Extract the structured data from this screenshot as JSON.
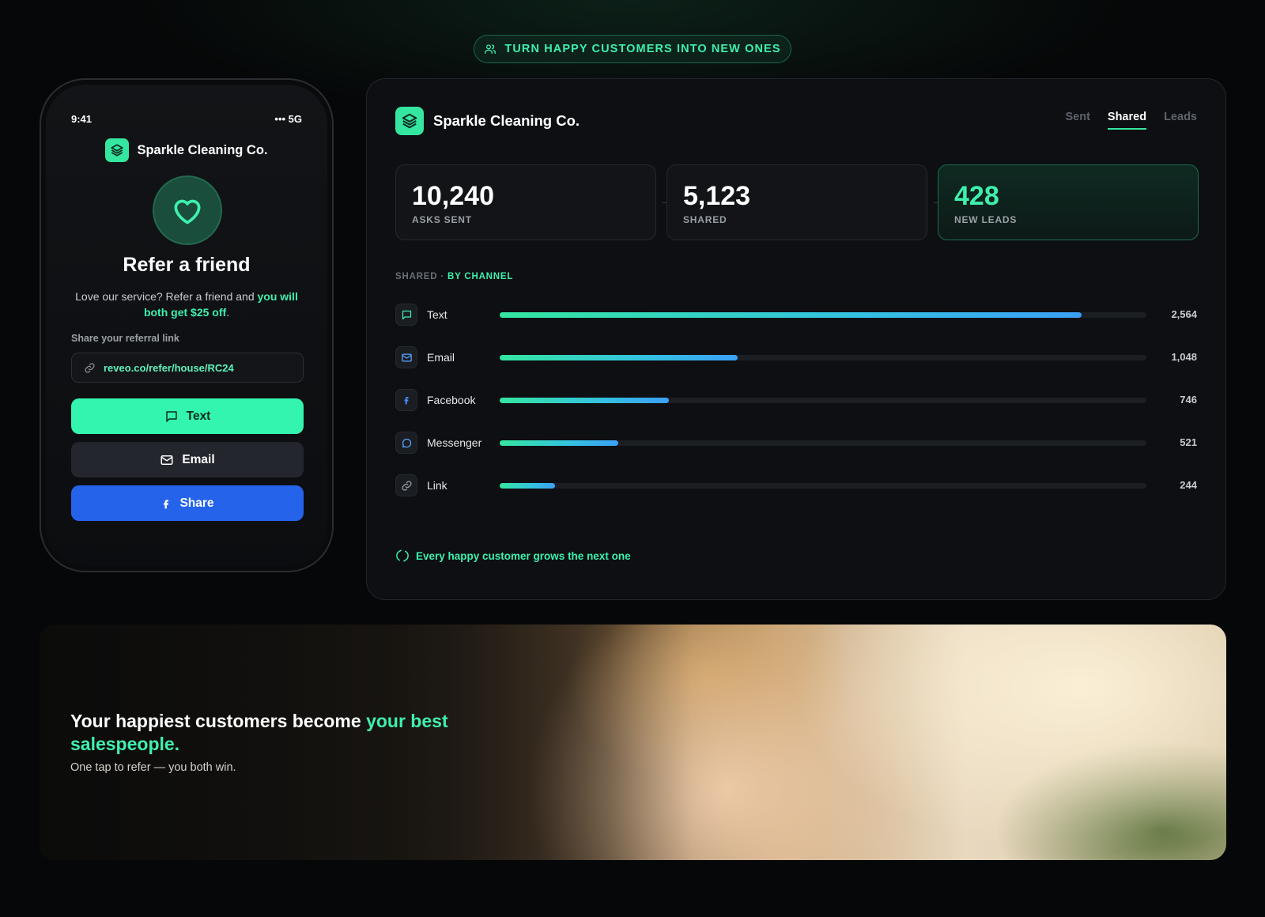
{
  "top_pill": {
    "label": "TURN HAPPY CUSTOMERS INTO NEW ONES",
    "icon": "users-icon"
  },
  "phone": {
    "time": "9:41",
    "signal": "••• 5G",
    "brand": "Sparkle Cleaning Co.",
    "title": "Refer a friend",
    "desc_prefix": "Love our service? Refer a friend and ",
    "desc_highlight": "you will both get $25 off",
    "desc_suffix": ".",
    "link_label": "Share your referral link",
    "link_value": "reveo.co/refer/house/RC24",
    "buttons": {
      "text": "Text",
      "email": "Email",
      "share": "Share"
    }
  },
  "dashboard": {
    "brand": "Sparkle Cleaning Co.",
    "tabs": [
      {
        "label": "Sent",
        "active": false
      },
      {
        "label": "Shared",
        "active": true
      },
      {
        "label": "Leads",
        "active": false
      }
    ],
    "stats": [
      {
        "value": "10,240",
        "label": "ASKS SENT"
      },
      {
        "value": "5,123",
        "label": "SHARED"
      },
      {
        "value": "428",
        "label": "NEW LEADS"
      }
    ],
    "section": {
      "prefix": "SHARED",
      "suffix": "BY CHANNEL"
    },
    "channels": [
      {
        "name": "Text",
        "value": 2564,
        "display": "2,564",
        "icon": "message-square-icon"
      },
      {
        "name": "Email",
        "value": 1048,
        "display": "1,048",
        "icon": "mail-icon"
      },
      {
        "name": "Facebook",
        "value": 746,
        "display": "746",
        "icon": "facebook-icon"
      },
      {
        "name": "Messenger",
        "value": 521,
        "display": "521",
        "icon": "message-circle-icon"
      },
      {
        "name": "Link",
        "value": 244,
        "display": "244",
        "icon": "link-icon"
      }
    ],
    "footer": "Every happy customer grows the next one"
  },
  "banner": {
    "head_prefix": "Your happiest customers become ",
    "head_highlight": "your best salespeople.",
    "sub": "One tap to refer — you both win."
  },
  "colors": {
    "accent": "#34e6a0",
    "facebook_blue": "#2563eb",
    "background": "#060708"
  }
}
